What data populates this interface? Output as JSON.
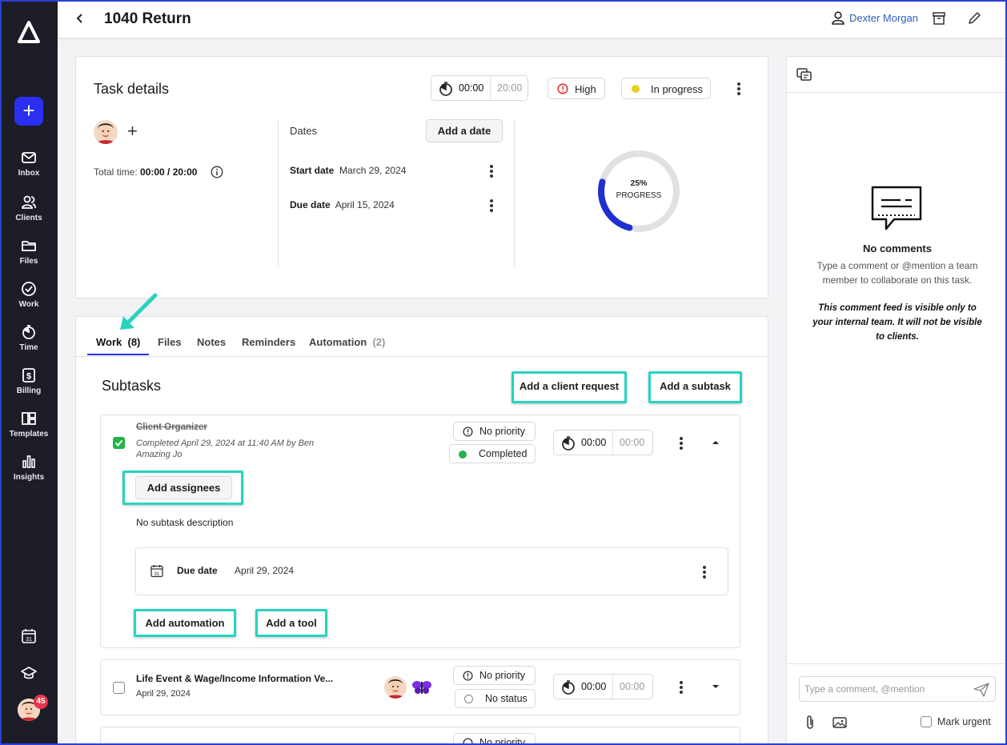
{
  "header": {
    "title": "1040 Return",
    "user": "Dexter Morgan"
  },
  "sidebar": {
    "items": [
      {
        "label": "Inbox",
        "icon": "envelope-icon"
      },
      {
        "label": "Clients",
        "icon": "people-icon"
      },
      {
        "label": "Files",
        "icon": "folder-icon"
      },
      {
        "label": "Work",
        "icon": "check-circle-icon"
      },
      {
        "label": "Time",
        "icon": "stopwatch-icon"
      },
      {
        "label": "Billing",
        "icon": "dollar-icon"
      },
      {
        "label": "Templates",
        "icon": "template-icon"
      },
      {
        "label": "Insights",
        "icon": "bar-chart-icon"
      }
    ],
    "notifications": "45"
  },
  "task": {
    "title": "Task details",
    "timer_elapsed": "00:00",
    "timer_budget": "20:00",
    "priority": "High",
    "status": "In progress",
    "total_time_label": "Total time:",
    "total_time_value": "00:00 / 20:00",
    "dates_label": "Dates",
    "add_date": "Add a date",
    "start_label": "Start date",
    "start_value": "March 29, 2024",
    "due_label": "Due date",
    "due_value": "April 15, 2024",
    "progress_percent": "25%",
    "progress_label": "PROGRESS",
    "progress_fraction": 0.25
  },
  "tabs": [
    {
      "label": "Work",
      "count": "(8)"
    },
    {
      "label": "Files"
    },
    {
      "label": "Notes"
    },
    {
      "label": "Reminders"
    },
    {
      "label": "Automation",
      "count": "(2)"
    }
  ],
  "subtasks": {
    "title": "Subtasks",
    "add_client_request": "Add a client request",
    "add_subtask": "Add a subtask",
    "items": [
      {
        "name": "Client Organizer",
        "completed_line1": "Completed April 29, 2024 at 11:40 AM by Ben",
        "completed_line2": "Amazing Jo",
        "priority": "No priority",
        "status": "Completed",
        "timer_elapsed": "00:00",
        "timer_budget": "00:00",
        "add_assignees": "Add assignees",
        "description": "No subtask description",
        "due_label": "Due date",
        "due_value": "April 29, 2024",
        "add_automation": "Add automation",
        "add_tool": "Add a tool"
      },
      {
        "name": "Life Event & Wage/Income Information Ve...",
        "date": "April 29, 2024",
        "priority": "No priority",
        "status": "No status",
        "timer_elapsed": "00:00",
        "timer_budget": "00:00"
      },
      {
        "priority": "No priority"
      }
    ]
  },
  "comments": {
    "empty_title": "No comments",
    "empty_text": "Type a comment or @mention a team member to collaborate on this task.",
    "note": "This comment feed is visible only to your internal team. It will not be visible to clients.",
    "placeholder": "Type a comment, @mention",
    "mark_urgent": "Mark urgent"
  },
  "colors": {
    "accent": "#2a2ff0",
    "highlight": "#27d3c0",
    "sidebar": "#1d1d27",
    "progress": "#1f2fd0",
    "completed": "#23b34a",
    "priority_high": "#e03a3a",
    "in_progress": "#e6d21e"
  }
}
